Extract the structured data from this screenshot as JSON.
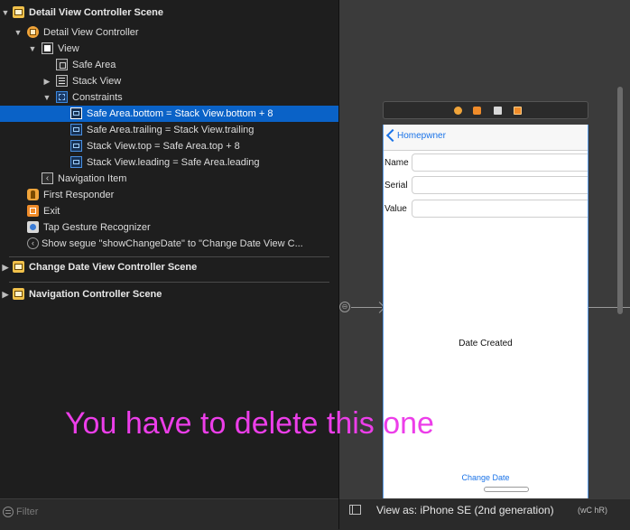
{
  "outline": {
    "rows": [
      {
        "label": "Detail View Controller Scene"
      },
      {
        "label": "Detail View Controller"
      },
      {
        "label": "View"
      },
      {
        "label": "Safe Area"
      },
      {
        "label": "Stack View"
      },
      {
        "label": "Constraints"
      },
      {
        "label": "Safe Area.bottom = Stack View.bottom + 8"
      },
      {
        "label": "Safe Area.trailing = Stack View.trailing"
      },
      {
        "label": "Stack View.top = Safe Area.top + 8"
      },
      {
        "label": "Stack View.leading = Safe Area.leading"
      },
      {
        "label": "Navigation Item"
      },
      {
        "label": "First Responder"
      },
      {
        "label": "Exit"
      },
      {
        "label": "Tap Gesture Recognizer"
      },
      {
        "label": "Show segue \"showChangeDate\" to \"Change Date View C..."
      },
      {
        "label": "Change Date View Controller Scene"
      },
      {
        "label": "Navigation Controller Scene"
      }
    ],
    "selected_index": 6
  },
  "filter": {
    "placeholder": "Filter"
  },
  "canvas": {
    "nav_back_label": "Homepwner",
    "fields": [
      {
        "label": "Name"
      },
      {
        "label": "Serial"
      },
      {
        "label": "Value"
      }
    ],
    "date_label": "Date Created",
    "change_date_label": "Change Date"
  },
  "bottom_bar": {
    "view_as": "View as: iPhone SE (2nd generation)",
    "size_class": "(wC hR)"
  },
  "annotation": {
    "text": "You have to delete this one",
    "color": "#ec3ee9"
  },
  "icons": {
    "scene": "storyboard-scene-icon",
    "view_controller": "view-controller-icon",
    "constraint": "constraint-icon",
    "navigation_item": "back-chevron-icon",
    "segue": "segue-icon"
  },
  "colors": {
    "selection": "#0a62c7",
    "link_blue": "#1a73e8"
  }
}
